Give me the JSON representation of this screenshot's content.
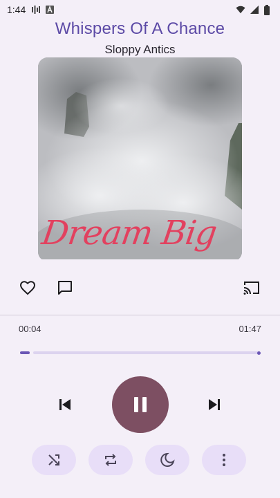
{
  "status_bar": {
    "time": "1:44",
    "left_icons": [
      "signal-bars-icon",
      "a-badge-icon"
    ],
    "right_icons": [
      "wifi-icon",
      "cellular-icon",
      "battery-icon"
    ]
  },
  "track": {
    "title": "Whispers Of A Chance",
    "artist": "Sloppy Antics"
  },
  "album_art": {
    "text": "Dream Big"
  },
  "actions": {
    "like_icon": "heart-outline-icon",
    "comment_icon": "comment-icon",
    "cast_icon": "cast-icon"
  },
  "progress": {
    "elapsed": "00:04",
    "total": "01:47",
    "fraction": 0.04
  },
  "controls": {
    "previous_icon": "skip-previous-icon",
    "play_pause_icon": "pause-icon",
    "next_icon": "skip-next-icon"
  },
  "bottom_actions": [
    "shuffle-icon",
    "repeat-icon",
    "sleep-timer-moon-icon",
    "more-vertical-icon"
  ],
  "colors": {
    "accent": "#6a56b5",
    "title": "#5c4aa6",
    "play_button": "#7d4f62",
    "pill": "#e8def8",
    "background": "#f4eff8"
  }
}
